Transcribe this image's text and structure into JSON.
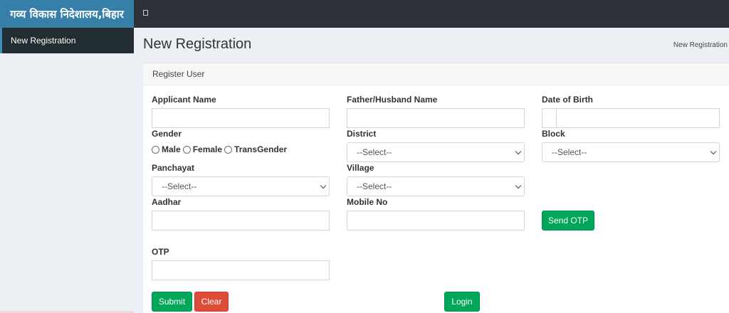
{
  "header": {
    "brand": "गव्य विकास निदेशालय,बिहार"
  },
  "sidebar": {
    "items": [
      {
        "label": "New Registration"
      }
    ]
  },
  "page": {
    "title": "New Registration",
    "breadcrumb": "New Registration"
  },
  "form": {
    "box_title": "Register User",
    "applicant_name": {
      "label": "Applicant Name",
      "value": ""
    },
    "father_name": {
      "label": "Father/Husband Name",
      "value": ""
    },
    "dob": {
      "label": "Date of Birth",
      "value": ""
    },
    "gender": {
      "label": "Gender",
      "options": [
        "Male",
        "Female",
        "TransGender"
      ]
    },
    "district": {
      "label": "District",
      "selected": "--Select--"
    },
    "block": {
      "label": "Block",
      "selected": "--Select--"
    },
    "panchayat": {
      "label": "Panchayat",
      "selected": "--Select--"
    },
    "village": {
      "label": "Village",
      "selected": "--Select--"
    },
    "aadhar": {
      "label": "Aadhar",
      "value": ""
    },
    "mobile": {
      "label": "Mobile No",
      "value": ""
    },
    "otp": {
      "label": "OTP",
      "value": ""
    },
    "buttons": {
      "send_otp": "Send OTP",
      "submit": "Submit",
      "clear": "Clear",
      "login": "Login"
    }
  },
  "colors": {
    "brand": "#367fa9",
    "topbar": "#2d3238",
    "sidebar_active": "#222d32",
    "success": "#00a65a",
    "danger": "#dd4b39"
  }
}
